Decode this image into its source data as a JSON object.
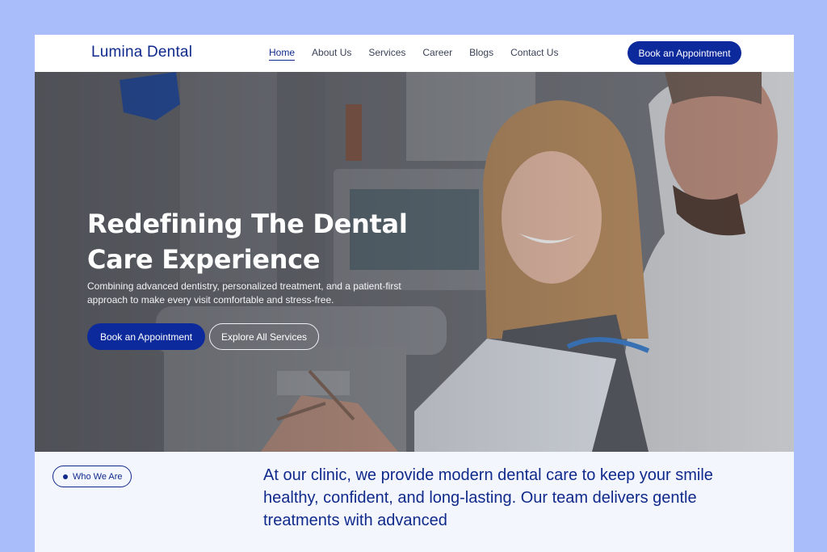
{
  "header": {
    "logo": "Lumina Dental",
    "nav": [
      {
        "label": "Home",
        "active": true
      },
      {
        "label": "About Us",
        "active": false
      },
      {
        "label": "Services",
        "active": false
      },
      {
        "label": "Career",
        "active": false
      },
      {
        "label": "Blogs",
        "active": false
      },
      {
        "label": "Contact Us",
        "active": false
      }
    ],
    "cta_label": "Book an Appointment"
  },
  "hero": {
    "title": "Redefining The Dental Care Experience",
    "subtitle": "Combining advanced dentistry, personalized treatment, and a patient-first approach to make every visit comfortable and stress-free.",
    "primary_button": "Book an Appointment",
    "secondary_button": "Explore All Services"
  },
  "about": {
    "tag": "Who We Are",
    "text": "At our clinic, we provide modern dental care to keep your smile healthy, confident, and long-lasting. Our team delivers gentle treatments with advanced"
  },
  "colors": {
    "page_background": "#a9bdfb",
    "brand": "#0c2a9c",
    "section_background": "#f4f6fd"
  }
}
